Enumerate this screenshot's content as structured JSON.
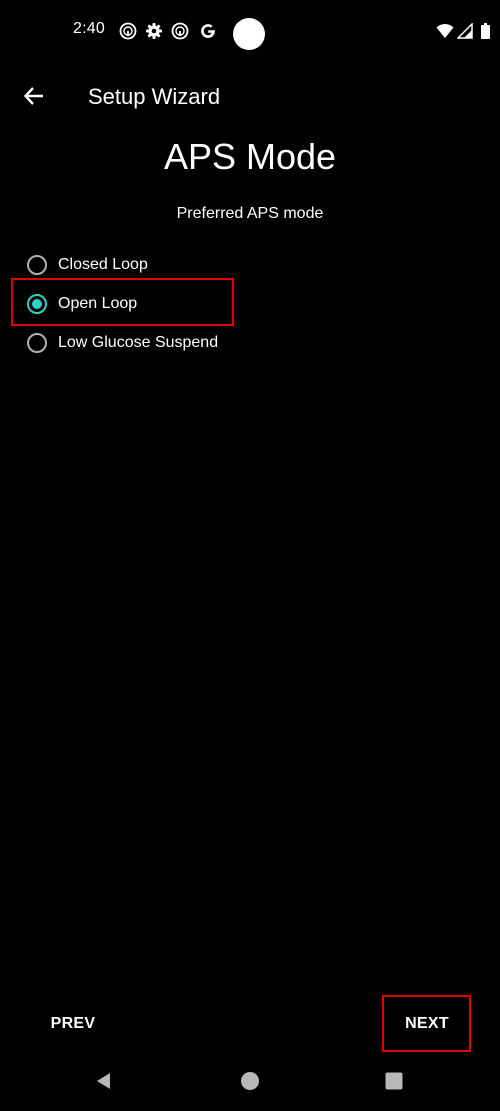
{
  "status_bar": {
    "time": "2:40",
    "icons": [
      "speedometer-icon",
      "gear-icon",
      "speedometer-icon",
      "google-g-icon"
    ],
    "right_icons": [
      "wifi-icon",
      "signal-icon",
      "battery-icon"
    ]
  },
  "app_bar": {
    "back_icon": "arrow-back-icon",
    "title": "Setup Wizard"
  },
  "page": {
    "title": "APS Mode",
    "subtitle": "Preferred APS mode",
    "options": [
      {
        "label": "Closed Loop",
        "checked": false
      },
      {
        "label": "Open Loop",
        "checked": true
      },
      {
        "label": "Low Glucose Suspend",
        "checked": false
      }
    ]
  },
  "buttons": {
    "prev_label": "PREV",
    "next_label": "NEXT"
  },
  "nav_bar": {
    "icons": [
      "back-triangle-icon",
      "home-circle-icon",
      "recents-square-icon"
    ]
  },
  "colors": {
    "background": "#000000",
    "accent": "#2fd1c2",
    "highlight": "#e00000",
    "text": "#ffffff"
  }
}
